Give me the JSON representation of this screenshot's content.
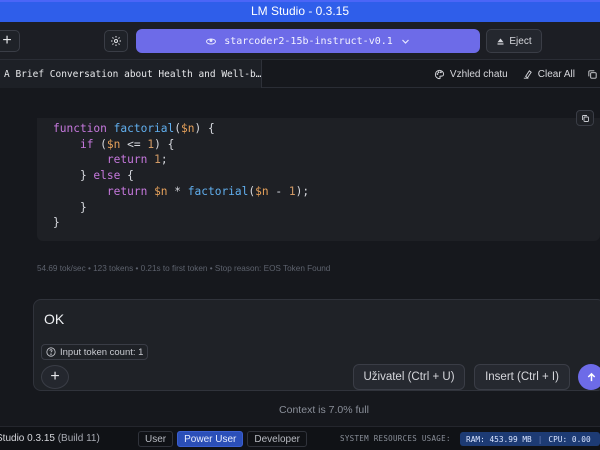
{
  "window": {
    "title": "LM Studio - 0.3.15"
  },
  "toolbar": {
    "new_label": "+",
    "model_name": "starcoder2-15b-instruct-v0.1",
    "eject_label": "Eject"
  },
  "tabs": {
    "active_title": "A Brief Conversation about Health and Well-b…",
    "appearance_label": "Vzhled chatu",
    "clear_label": "Clear All"
  },
  "code": {
    "lines": [
      [
        "function factorial($n) {"
      ],
      [
        "if ($n <= 1) {"
      ],
      [
        "return 1;"
      ],
      [
        "} else {"
      ],
      [
        "return $n * factorial($n - 1);"
      ],
      [
        "}"
      ],
      [
        "}"
      ]
    ]
  },
  "stats": {
    "text": "54.69 tok/sec • 123 tokens • 0.21s to first token • Stop reason: EOS Token Found"
  },
  "input": {
    "value": "OK",
    "token_count_label": "Input token count: 1",
    "attach_label": "+",
    "user_button": "Uživatel (Ctrl + U)",
    "insert_button": "Insert (Ctrl + I)"
  },
  "context": {
    "text": "Context is 7.0% full"
  },
  "status": {
    "version": "Studio 0.3.15",
    "build": "(Build 11)",
    "modes": [
      "User",
      "Power User",
      "Developer"
    ],
    "active_mode": "Power User",
    "sys_label": "SYSTEM RESOURCES USAGE:",
    "ram": "RAM: 453.99 MB",
    "cpu": "CPU: 0.00"
  },
  "colors": {
    "title_bar": "#2f5eea",
    "accent": "#6d6be8",
    "background": "#16181d"
  }
}
